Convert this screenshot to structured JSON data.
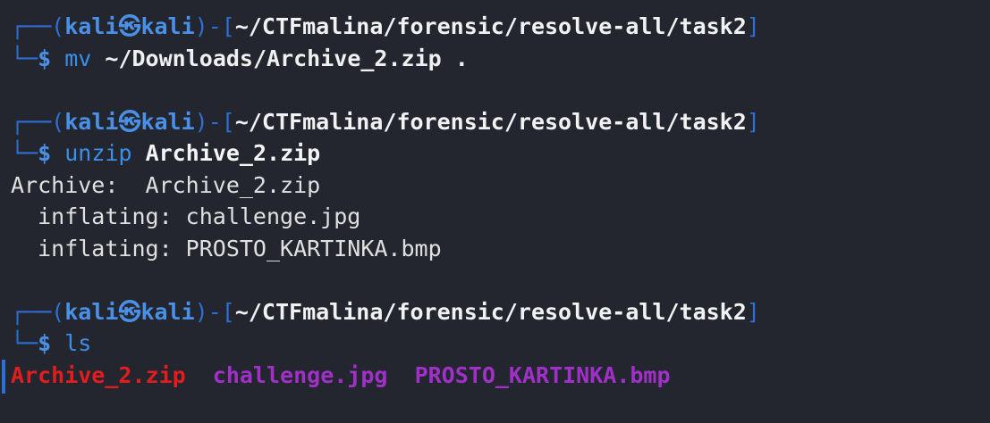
{
  "colors": {
    "background": "#23262e",
    "prompt_blue": "#2e6fd4",
    "user_blue": "#4a90e6",
    "zip_red": "#e11d1d",
    "image_purple": "#a030c8"
  },
  "prompt": {
    "open": "┌──(",
    "user": "kali",
    "icon": "㉿",
    "host": "kali",
    "close_open": ")-[",
    "path": "~/CTFmalina/forensic/resolve-all/task2",
    "close": "]",
    "second_line": "└─",
    "dollar": "$"
  },
  "commands": [
    {
      "cmd": "mv",
      "args": "~/Downloads/Archive_2.zip ."
    },
    {
      "cmd": "unzip",
      "args": "Archive_2.zip",
      "output": [
        "Archive:  Archive_2.zip",
        "  inflating: challenge.jpg",
        "  inflating: PROSTO_KARTINKA.bmp"
      ]
    },
    {
      "cmd": "ls",
      "args": "",
      "listing": [
        {
          "name": "Archive_2.zip",
          "kind": "archive"
        },
        {
          "name": "challenge.jpg",
          "kind": "image"
        },
        {
          "name": "PROSTO_KARTINKA.bmp",
          "kind": "image"
        }
      ]
    }
  ]
}
